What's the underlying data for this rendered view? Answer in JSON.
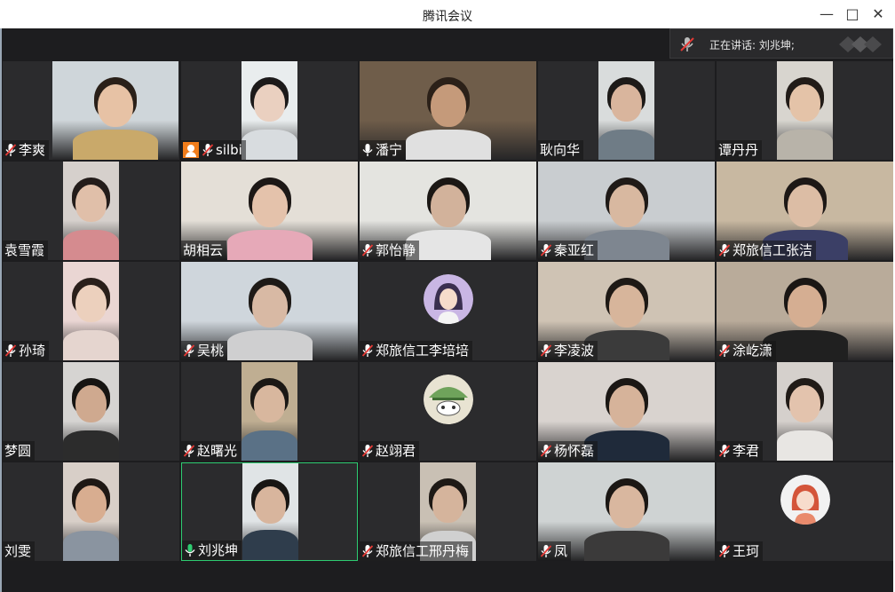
{
  "window": {
    "title": "腾讯会议"
  },
  "speaking": {
    "text": "正在讲话: 刘兆坤;"
  },
  "participants": [
    {
      "name": "李爽",
      "mic": "muted",
      "bg": "#cfd6da",
      "skin": "#e7c2a5",
      "hair": "#2a2019",
      "shirt": "#c9a96a"
    },
    {
      "name": "silbi",
      "mic": "muted",
      "host": true,
      "bg": "#e9edee",
      "skin": "#ead0c0",
      "hair": "#1c1a1a",
      "shirt": "#d8dcdf"
    },
    {
      "name": "潘宁",
      "mic": "on",
      "bg": "#6f5d4a",
      "skin": "#c59a7a",
      "hair": "#2b2018",
      "shirt": "#e0e0e0"
    },
    {
      "name": "耿向华",
      "mic": "none",
      "bg": "#d9dcdc",
      "skin": "#d9b59d",
      "hair": "#1d1a18",
      "shirt": "#6f7c86"
    },
    {
      "name": "谭丹丹",
      "mic": "none",
      "bg": "#d8d5cf",
      "skin": "#e4c3a8",
      "hair": "#221c18",
      "shirt": "#b8b3a9"
    },
    {
      "name": "袁雪霞",
      "mic": "none",
      "bg": "#d6d0cc",
      "skin": "#e0bfa9",
      "hair": "#231c1a",
      "shirt": "#d58b8f"
    },
    {
      "name": "胡相云",
      "mic": "none",
      "bg": "#e4dfd7",
      "skin": "#e4c2ab",
      "hair": "#1d1816",
      "shirt": "#e6a9b8"
    },
    {
      "name": "郭怡静",
      "mic": "muted",
      "bg": "#e4e4e0",
      "skin": "#d2b29b",
      "hair": "#1b1714",
      "shirt": "#e5e5e5"
    },
    {
      "name": "秦亚红",
      "mic": "muted",
      "bg": "#c9cdd0",
      "skin": "#d8b8a0",
      "hair": "#1f1a17",
      "shirt": "#7e8690"
    },
    {
      "name": "郑旅信工张洁",
      "mic": "muted",
      "bg": "#c8b8a1",
      "skin": "#dcbda5",
      "hair": "#1d1816",
      "shirt": "#3b3f66"
    },
    {
      "name": "孙琦",
      "mic": "muted",
      "bg": "#ead6d3",
      "skin": "#ecd0bd",
      "hair": "#2a1f1a",
      "shirt": "#e5d5cf"
    },
    {
      "name": "吴桃",
      "mic": "muted",
      "bg": "#cfd6dc",
      "skin": "#d8b9a4",
      "hair": "#1e1a17",
      "shirt": "#cfcfd0"
    },
    {
      "name": "郑旅信工李培培",
      "mic": "muted",
      "avatar": "girl-purple",
      "bg": "#2b2b2d"
    },
    {
      "name": "李凌波",
      "mic": "muted",
      "bg": "#cfc3b4",
      "skin": "#d7b59b",
      "hair": "#1e1915",
      "shirt": "#3b3b3b"
    },
    {
      "name": "涂屹潇",
      "mic": "muted",
      "bg": "#b9ab9a",
      "skin": "#d5ae92",
      "hair": "#1a1614",
      "shirt": "#202020"
    },
    {
      "name": "梦圆",
      "mic": "none",
      "bg": "#d6d4d2",
      "skin": "#cfa98f",
      "hair": "#161412",
      "shirt": "#2c2c2c"
    },
    {
      "name": "赵曙光",
      "mic": "muted",
      "bg": "#bfae92",
      "skin": "#d8b79e",
      "hair": "#1b1815",
      "shirt": "#5a7186"
    },
    {
      "name": "赵翊君",
      "mic": "muted",
      "avatar": "cartoon-green",
      "bg": "#2b2b2d"
    },
    {
      "name": "杨怀磊",
      "mic": "muted",
      "bg": "#d9d3cf",
      "skin": "#d6b39a",
      "hair": "#1b1714",
      "shirt": "#1f2a3a"
    },
    {
      "name": "李君",
      "mic": "muted",
      "bg": "#d5d0cc",
      "skin": "#e3c3ad",
      "hair": "#211b17",
      "shirt": "#e8e6e3"
    },
    {
      "name": "刘雯",
      "mic": "none",
      "bg": "#d8cfc8",
      "skin": "#d8ad90",
      "hair": "#1f1814",
      "shirt": "#8a94a0"
    },
    {
      "name": "刘兆坤",
      "mic": "speaking",
      "active": true,
      "bg": "#e0e4e6",
      "skin": "#d8b59d",
      "hair": "#181614",
      "shirt": "#2f3d4c"
    },
    {
      "name": "郑旅信工邢丹梅",
      "mic": "muted",
      "bg": "#c9c0b4",
      "skin": "#d5b49c",
      "hair": "#1e1915",
      "shirt": "#d0d0d0"
    },
    {
      "name": "凤",
      "mic": "muted",
      "bg": "#cfd3d3",
      "skin": "#d9b79f",
      "hair": "#1b1714",
      "shirt": "#3b3a3a"
    },
    {
      "name": "王珂",
      "mic": "muted",
      "avatar": "girl-red",
      "bg": "#2b2b2d"
    }
  ],
  "colors": {
    "muted_red": "#e53935",
    "speaking_green": "#2ecc71",
    "active_border": "#2ecc71"
  }
}
